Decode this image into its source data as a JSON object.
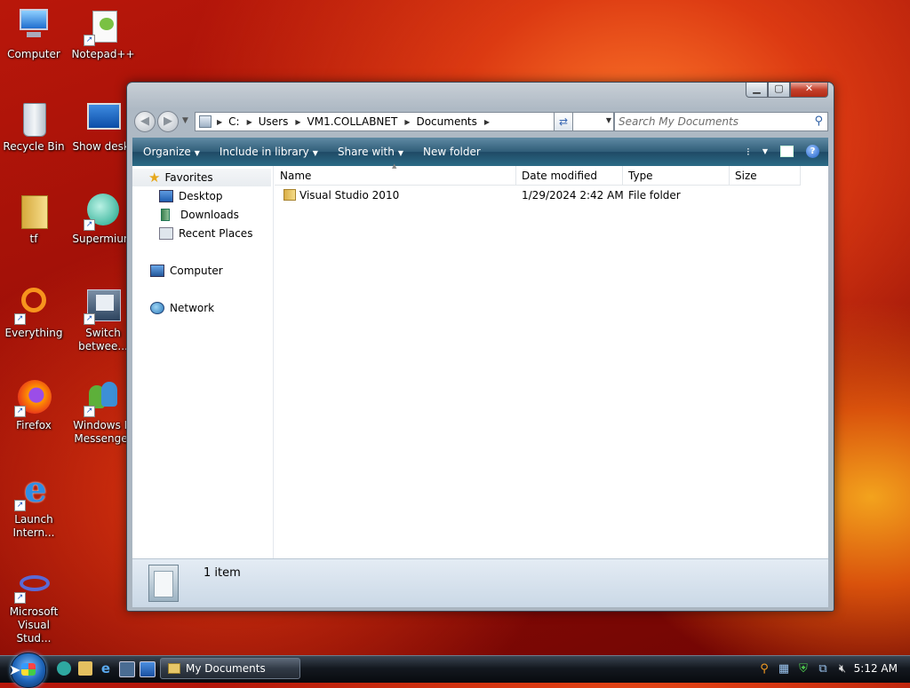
{
  "desktop": {
    "icons": [
      {
        "label": "Computer"
      },
      {
        "label": "Notepad++"
      },
      {
        "label": "Recycle Bin"
      },
      {
        "label": "Show deskt"
      },
      {
        "label": "tf"
      },
      {
        "label": "Supermium"
      },
      {
        "label": "Everything"
      },
      {
        "label": "Switch betwee..."
      },
      {
        "label": "Firefox"
      },
      {
        "label": "Windows Li Messenger"
      },
      {
        "label": "Launch Intern..."
      },
      {
        "label": "Microsoft Visual Stud..."
      }
    ]
  },
  "window": {
    "address": {
      "crumbs": [
        "C:",
        "Users",
        "VM1.COLLABNET",
        "Documents"
      ]
    },
    "search": {
      "placeholder": "Search My Documents"
    },
    "toolbar": {
      "organize": "Organize",
      "include_in_library": "Include in library",
      "share_with": "Share with",
      "new_folder": "New folder"
    },
    "nav": {
      "favorites": "Favorites",
      "desktop": "Desktop",
      "downloads": "Downloads",
      "recent_places": "Recent Places",
      "computer": "Computer",
      "network": "Network"
    },
    "columns": {
      "name": "Name",
      "date_modified": "Date modified",
      "type": "Type",
      "size": "Size"
    },
    "files": [
      {
        "name": "Visual Studio 2010",
        "date_modified": "1/29/2024 2:42 AM",
        "type": "File folder",
        "size": ""
      }
    ],
    "status": {
      "item_count": "1 item"
    }
  },
  "taskbar": {
    "active_window": "My Documents",
    "clock": "5:12 AM"
  },
  "colors": {
    "toolbar": "#2f5d78",
    "desktop_bg": "#b9170a",
    "close_button": "#c5402b"
  }
}
